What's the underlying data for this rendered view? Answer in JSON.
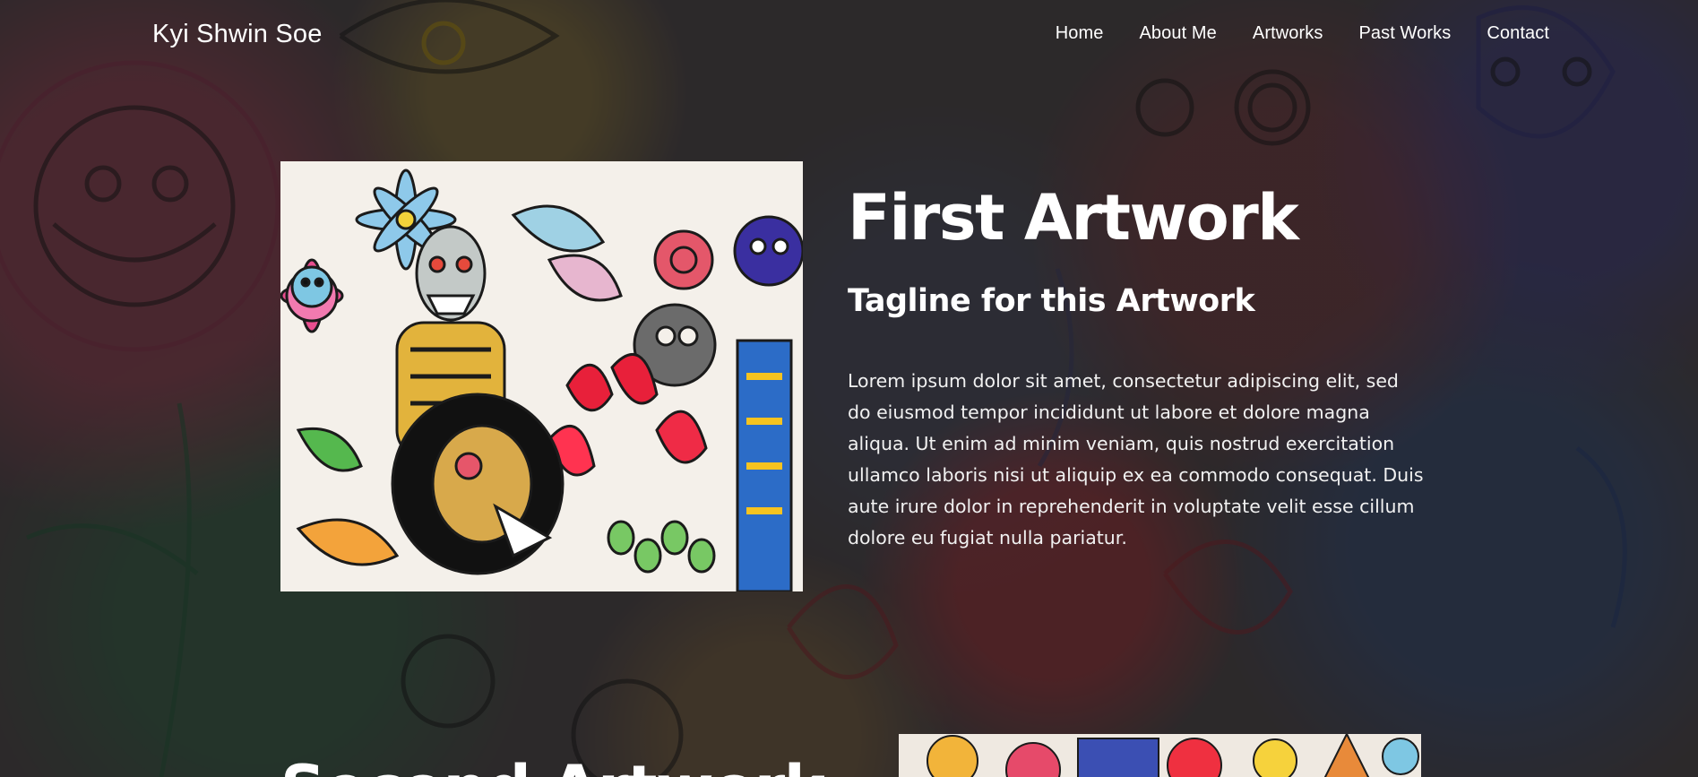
{
  "header": {
    "brand": "Kyi Shwin Soe",
    "nav": [
      {
        "label": "Home"
      },
      {
        "label": "About Me"
      },
      {
        "label": "Artworks"
      },
      {
        "label": "Past Works"
      },
      {
        "label": "Contact"
      }
    ]
  },
  "artworks": [
    {
      "title": "First Artwork",
      "tagline": "Tagline for this Artwork",
      "description": "Lorem ipsum dolor sit amet, consectetur adipiscing elit, sed do eiusmod tempor incididunt ut labore et dolore magna aliqua. Ut enim ad minim veniam, quis nostrud exercitation ullamco laboris nisi ut aliquip ex ea commodo consequat. Duis aute irure dolor in reprehenderit in voluptate velit esse cillum dolore eu fugiat nulla pariatur."
    },
    {
      "title": "Second Artwork"
    }
  ],
  "colors": {
    "text": "#ffffff",
    "overlay": "#1c1c1c"
  }
}
